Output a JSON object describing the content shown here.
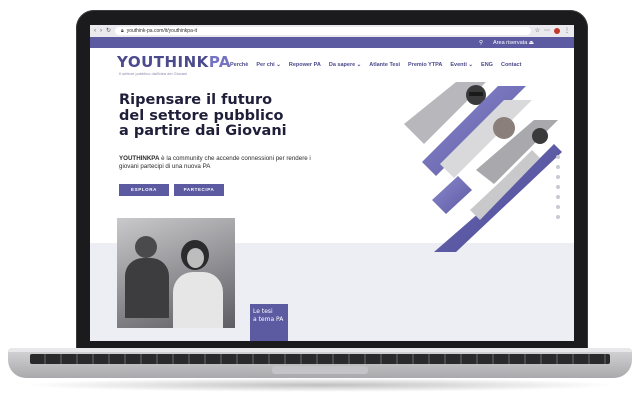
{
  "browser": {
    "url": "youthink-pa.com/it/youthinkpa-it"
  },
  "topbar": {
    "area_label": "Area riservata",
    "lock_icon": "lock-icon"
  },
  "brand": {
    "logo_main": "YOUTHINK",
    "logo_accent": "PA",
    "tagline": "Il settore pubblico dall'idea dei Giovani"
  },
  "nav": {
    "items": [
      "Perchè",
      "Per chi ⌄",
      "Repower PA",
      "Da sapere ⌄",
      "Atlante Tesi",
      "Premio YTPA",
      "Eventi ⌄",
      "ENG",
      "Contact"
    ]
  },
  "hero": {
    "title_lines": [
      "Ripensare il futuro",
      "del settore pubblico",
      "a partire dai Giovani"
    ],
    "desc_brand": "YOUTHINKPA",
    "desc_rest": " è la community che accende connessioni per rendere i giovani partecipi di una nuova PA",
    "btn_explore": "ESPLORA",
    "btn_partecipa": "PARTECIPA"
  },
  "card": {
    "label_lines": [
      "Le tesi",
      "a tema PA"
    ]
  },
  "colors": {
    "accent": "#5c5aa0",
    "logo": "#4b4a8c",
    "title": "#1f1f3a"
  }
}
